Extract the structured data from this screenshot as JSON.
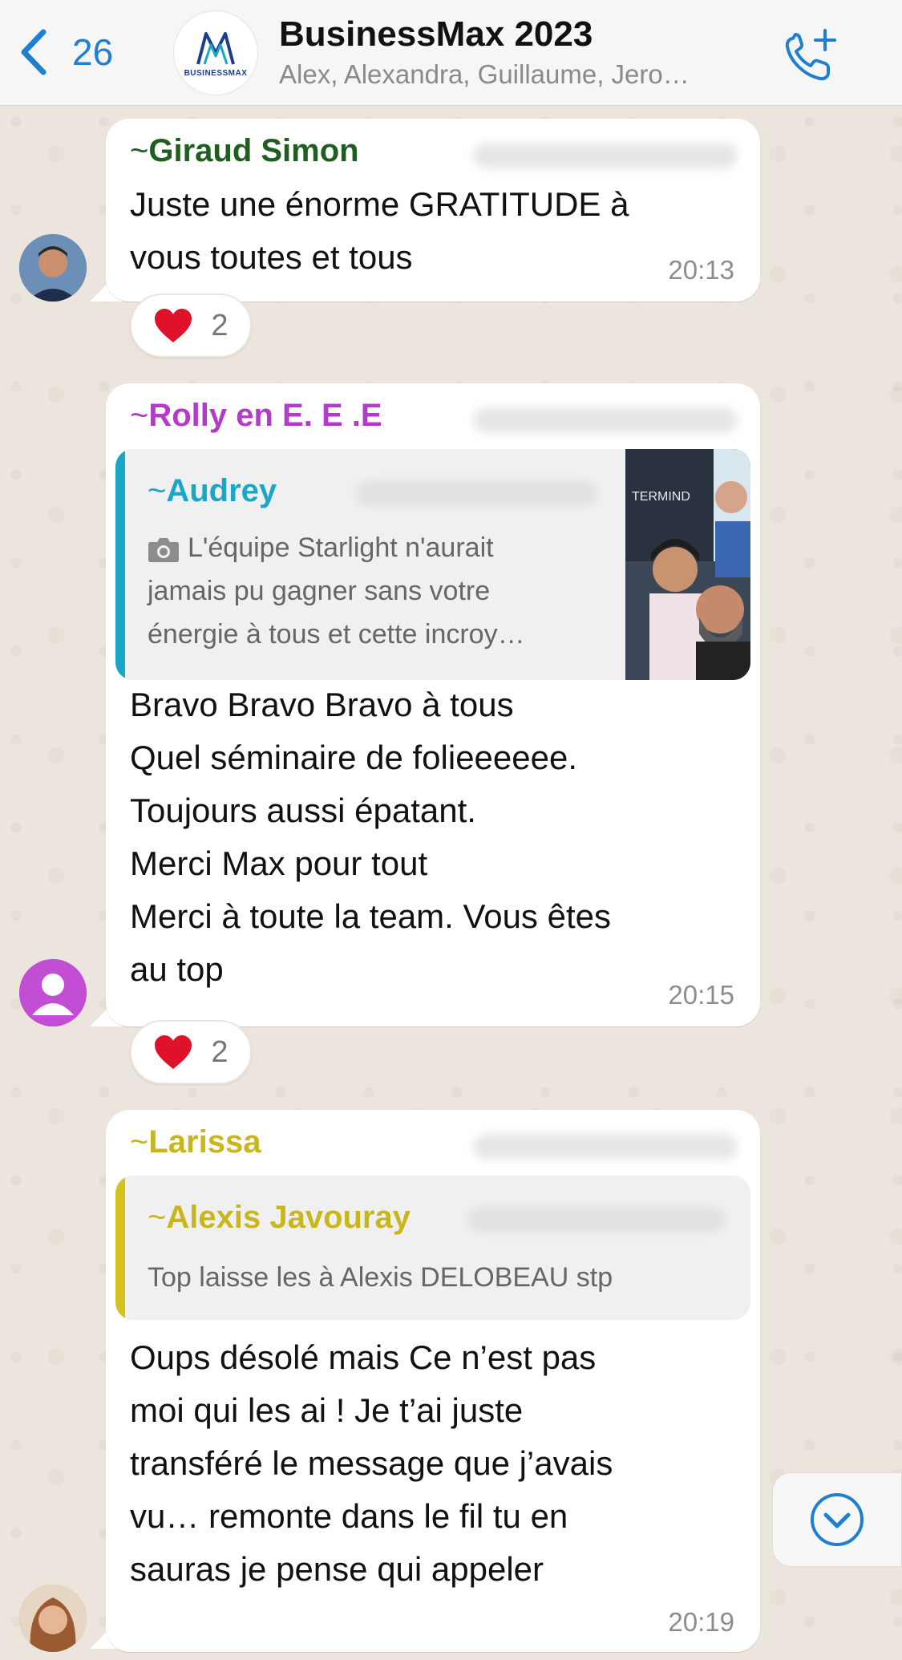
{
  "header": {
    "back_count": "26",
    "title": "BusinessMax 2023",
    "subtitle": "Alex, Alexandra, Guillaume, Jero…",
    "logo_text": "BUSINESSMAX"
  },
  "messages": [
    {
      "sender": "Giraud Simon",
      "sender_color": "#1f5e1f",
      "text": "Juste une énorme GRATITUDE à\nvous toutes et tous",
      "time": "20:13",
      "reaction": {
        "emoji": "heart",
        "count": "2"
      }
    },
    {
      "sender": "Rolly en E. E .E",
      "sender_color": "#b23cc9",
      "quote": {
        "sender": "Audrey",
        "sender_color": "#1aa7c6",
        "text": "L'équipe Starlight n'aurait\njamais pu gagner sans votre\nénergie à tous et cette incroy…",
        "photo_text": "TERMIND"
      },
      "text": "Bravo Bravo Bravo à tous\nQuel séminaire de folieeeeee.\nToujours aussi épatant.\nMerci Max pour tout\nMerci à toute la team. Vous êtes\nau top",
      "time": "20:15",
      "reaction": {
        "emoji": "heart",
        "count": "2"
      }
    },
    {
      "sender": "Larissa",
      "sender_color": "#c9b61d",
      "quote": {
        "sender": "Alexis Javouray",
        "sender_color": "#c9b61d",
        "text": "Top laisse les à Alexis DELOBEAU stp"
      },
      "text": "Oups désolé mais Ce n’est pas\nmoi qui les ai ! Je t’ai juste\ntransféré le message que j’avais\nvu… remonte dans le fil tu en\nsauras je pense qui appeler",
      "time": "20:19"
    }
  ],
  "tilde": "~",
  "icons": {
    "back": "chevron-left-icon",
    "call_add": "phone-plus-icon",
    "scroll_down": "chevron-down-circle-icon",
    "camera": "camera-icon",
    "heart": "heart-icon"
  },
  "colors": {
    "accent": "#1f7fd1",
    "header_bg": "#f6f6f6",
    "wallpaper": "#ece5dd"
  }
}
